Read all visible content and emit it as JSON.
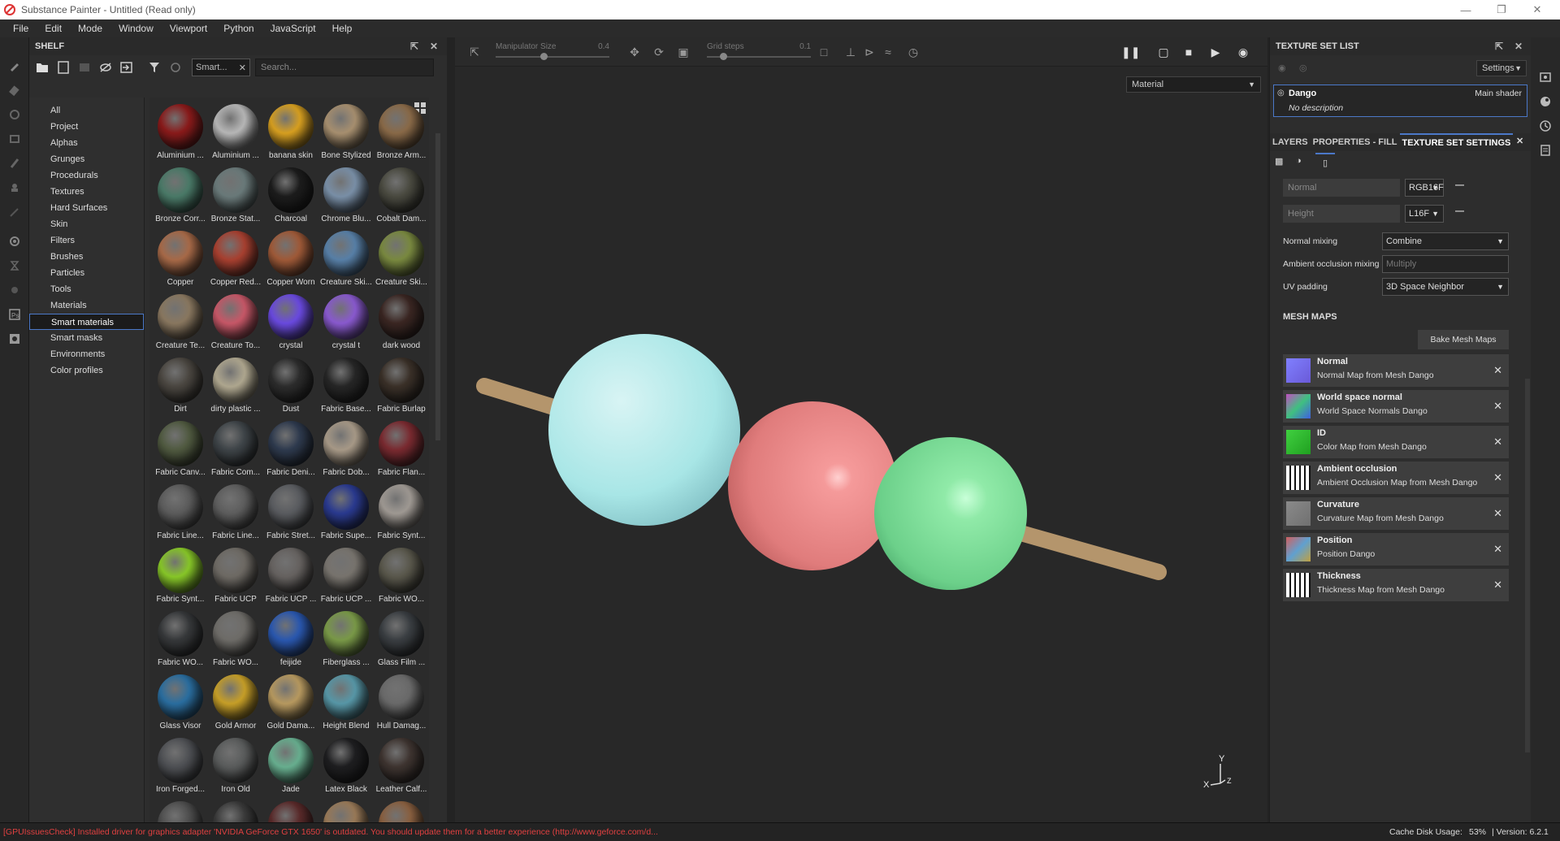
{
  "window": {
    "title": "Substance Painter - Untitled (Read only)"
  },
  "menu": [
    "File",
    "Edit",
    "Mode",
    "Window",
    "Viewport",
    "Python",
    "JavaScript",
    "Help"
  ],
  "shelf": {
    "title": "SHELF",
    "filter_chip": "Smart...",
    "search_placeholder": "Search...",
    "categories": [
      "All",
      "Project",
      "Alphas",
      "Grunges",
      "Procedurals",
      "Textures",
      "Hard Surfaces",
      "Skin",
      "Filters",
      "Brushes",
      "Particles",
      "Tools",
      "Materials",
      "Smart materials",
      "Smart masks",
      "Environments",
      "Color profiles"
    ],
    "selected_category": "Smart materials",
    "materials": [
      "Aluminium ...",
      "Aluminium ...",
      "banana skin",
      "Bone Stylized",
      "Bronze Arm...",
      "Bronze Corr...",
      "Bronze Stat...",
      "Charcoal",
      "Chrome Blu...",
      "Cobalt Dam...",
      "Copper",
      "Copper Red...",
      "Copper Worn",
      "Creature Ski...",
      "Creature Ski...",
      "Creature Te...",
      "Creature To...",
      "crystal",
      "crystal t",
      "dark wood",
      "Dirt",
      "dirty plastic ...",
      "Dust",
      "Fabric Base...",
      "Fabric Burlap",
      "Fabric Canv...",
      "Fabric Com...",
      "Fabric Deni...",
      "Fabric Dob...",
      "Fabric Flan...",
      "Fabric Line...",
      "Fabric Line...",
      "Fabric Stret...",
      "Fabric Supe...",
      "Fabric Synt...",
      "Fabric Synt...",
      "Fabric UCP",
      "Fabric UCP ...",
      "Fabric UCP ...",
      "Fabric WO...",
      "Fabric WO...",
      "Fabric WO...",
      "feijide",
      "Fiberglass ...",
      "Glass Film ...",
      "Glass Visor",
      "Gold Armor",
      "Gold Dama...",
      "Height Blend",
      "Hull Damag...",
      "Iron Forged...",
      "Iron Old",
      "Jade",
      "Latex Black",
      "Leather Calf..."
    ],
    "material_colors": [
      "#8a1a1a",
      "#b8b8b8",
      "#d8a020",
      "#a89070",
      "#8a6a48",
      "#4a7a68",
      "#6a7a7a",
      "#1c1c1c",
      "#7a90a8",
      "#4a4a40",
      "#a86a48",
      "#a84030",
      "#a05a38",
      "#5880a8",
      "#7a8a40",
      "#8a7860",
      "#c85868",
      "#6a4ae0",
      "#8a5ad0",
      "#3a2622",
      "#4a4640",
      "#b0a890",
      "#2c2c2c",
      "#262626",
      "#3a3028",
      "#505a40",
      "#3e4448",
      "#2e3a4e",
      "#a89a88",
      "#7a2a30",
      "#5c5c5c",
      "#5e5e5e",
      "#5a5c60",
      "#2a3a90",
      "#a09a94",
      "#88c828",
      "#6e6a64",
      "#666260",
      "#78746e",
      "#5a584c",
      "#36383a",
      "#6e6c68",
      "#2a58b0",
      "#7a9a48",
      "#3a3e42",
      "#2a6ea0",
      "#c8a028",
      "#b89a60",
      "#5898a8",
      "#6a6a6a",
      "#4e5054",
      "#5a5c5c",
      "#68b090",
      "#1e1e20",
      "#3e3430"
    ],
    "partial_row_colors": [
      "#4e4e4e",
      "#3a3a3a",
      "#5a2a2a",
      "#9a7a58",
      "#8a6040"
    ]
  },
  "viewport": {
    "manipulator_label": "Manipulator Size",
    "manipulator_value": "0.4",
    "grid_label": "Grid steps",
    "grid_value": "0.1",
    "material_mode": "Material",
    "axis_y": "Y",
    "axis_x": "X",
    "axis_z": "Z"
  },
  "texture_set_list": {
    "title": "TEXTURE SET LIST",
    "settings_label": "Settings",
    "set_name": "Dango",
    "shader": "Main shader",
    "description": "No description"
  },
  "tabs": {
    "layers": "LAYERS",
    "properties": "PROPERTIES - FILL",
    "tss": "TEXTURE SET SETTINGS"
  },
  "tss": {
    "channels": [
      {
        "name": "Normal",
        "format": "RGB16F"
      },
      {
        "name": "Height",
        "format": "L16F"
      }
    ],
    "normal_mixing_label": "Normal mixing",
    "normal_mixing_value": "Combine",
    "ao_mixing_label": "Ambient occlusion mixing",
    "ao_mixing_value": "Multiply",
    "uv_padding_label": "UV padding",
    "uv_padding_value": "3D Space Neighbor",
    "mesh_maps_title": "MESH MAPS",
    "bake_label": "Bake Mesh Maps",
    "mesh_maps": [
      {
        "name": "Normal",
        "desc": "Normal Map from Mesh Dango"
      },
      {
        "name": "World space normal",
        "desc": "World Space Normals Dango"
      },
      {
        "name": "ID",
        "desc": "Color Map from Mesh Dango"
      },
      {
        "name": "Ambient occlusion",
        "desc": "Ambient Occlusion Map from Mesh Dango"
      },
      {
        "name": "Curvature",
        "desc": "Curvature Map from Mesh Dango"
      },
      {
        "name": "Position",
        "desc": "Position Dango"
      },
      {
        "name": "Thickness",
        "desc": "Thickness Map from Mesh Dango"
      }
    ]
  },
  "status": {
    "message": "[GPUIssuesCheck] Installed driver for graphics adapter 'NVIDIA GeForce GTX 1650' is outdated. You should update them for a better experience (http://www.geforce.com/d...",
    "cache_label": "Cache Disk Usage:",
    "cache_value": "53%",
    "version": "| Version: 6.2.1",
    "error_color": "#e04040"
  }
}
